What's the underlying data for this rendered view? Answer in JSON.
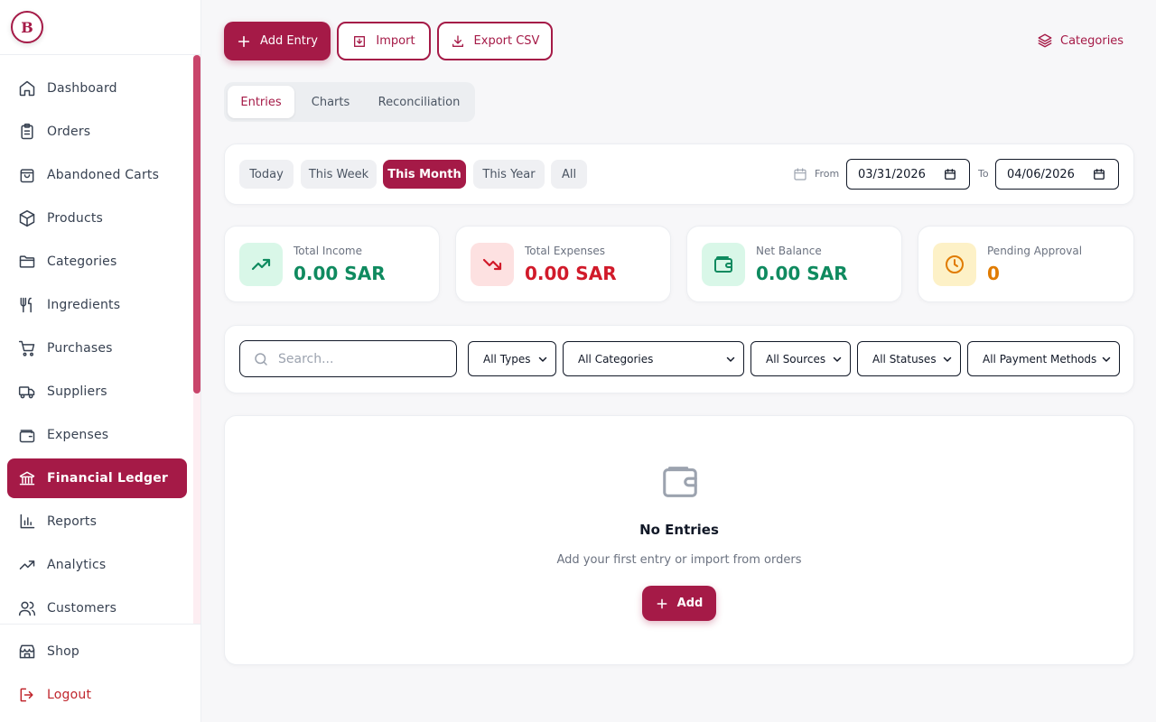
{
  "brand": {
    "logo_letter": "B",
    "accent": "#a51a47"
  },
  "sidebar": {
    "items": [
      {
        "label": "Dashboard",
        "icon": "home-icon"
      },
      {
        "label": "Orders",
        "icon": "clipboard-icon"
      },
      {
        "label": "Abandoned Carts",
        "icon": "bag-icon"
      },
      {
        "label": "Products",
        "icon": "box-icon"
      },
      {
        "label": "Categories",
        "icon": "folder-icon"
      },
      {
        "label": "Ingredients",
        "icon": "utensils-icon"
      },
      {
        "label": "Purchases",
        "icon": "cart-icon"
      },
      {
        "label": "Suppliers",
        "icon": "truck-icon"
      },
      {
        "label": "Expenses",
        "icon": "wallet-icon"
      },
      {
        "label": "Financial Ledger",
        "icon": "bank-icon",
        "active": true
      },
      {
        "label": "Reports",
        "icon": "bar-chart-icon"
      },
      {
        "label": "Analytics",
        "icon": "trending-up-icon"
      },
      {
        "label": "Customers",
        "icon": "users-icon"
      }
    ],
    "bottom": [
      {
        "label": "Shop",
        "icon": "store-icon"
      },
      {
        "label": "Logout",
        "icon": "logout-icon"
      }
    ]
  },
  "toolbar": {
    "add_entry": "Add Entry",
    "import": "Import",
    "export_csv": "Export CSV",
    "categories": "Categories"
  },
  "tabs": [
    "Entries",
    "Charts",
    "Reconciliation"
  ],
  "period": {
    "options": [
      "Today",
      "This Week",
      "This Month",
      "This Year",
      "All"
    ],
    "selected": "This Month",
    "from_label": "From",
    "from_value": "03/31/2026",
    "to_label": "To",
    "to_value": "04/06/2026"
  },
  "stats": [
    {
      "title": "Total Income",
      "value": "0.00 SAR",
      "color": "#0f8a5f",
      "bg": "#d9f7e8",
      "icon": "trending-up-icon"
    },
    {
      "title": "Total Expenses",
      "value": "0.00 SAR",
      "color": "#d11a2a",
      "bg": "#fde1e1",
      "icon": "trending-down-icon"
    },
    {
      "title": "Net Balance",
      "value": "0.00 SAR",
      "color": "#0f8a5f",
      "bg": "#d9f7e8",
      "icon": "wallet-icon"
    },
    {
      "title": "Pending Approval",
      "value": "0",
      "color": "#e07b00",
      "bg": "#fdf1c7",
      "icon": "clock-icon"
    }
  ],
  "filters": {
    "search_placeholder": "Search...",
    "types": "All Types",
    "categories": "All Categories",
    "sources": "All Sources",
    "statuses": "All Statuses",
    "payment_methods": "All Payment Methods"
  },
  "empty": {
    "title": "No Entries",
    "subtitle": "Add your first entry or import from orders",
    "button": "Add"
  }
}
